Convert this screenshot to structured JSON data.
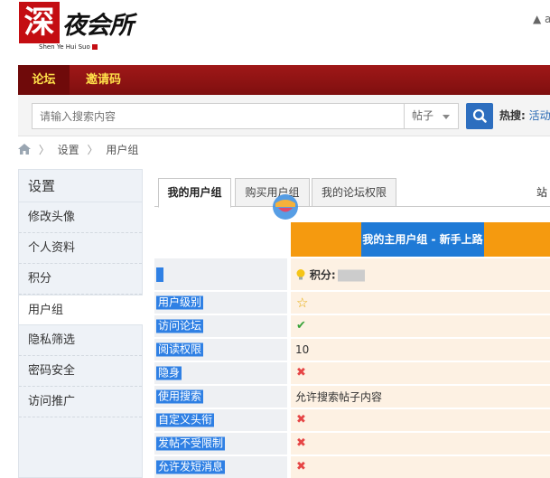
{
  "logo": {
    "mark": "深",
    "name": "夜会所",
    "subtitle": "Shen Ye Hui Suo"
  },
  "user_mini": "▲ a",
  "nav": {
    "items": [
      "论坛",
      "邀请码"
    ]
  },
  "search": {
    "placeholder": "请输入搜索内容",
    "type_value": "帖子",
    "hot_label": "热搜:",
    "hot_item": "活动"
  },
  "breadcrumb": {
    "items": [
      "设置",
      "用户组"
    ]
  },
  "sidebar": {
    "title": "设置",
    "items": [
      "修改头像",
      "个人资料",
      "积分",
      "用户组",
      "隐私筛选",
      "密码安全",
      "访问推广"
    ],
    "active_index": 3
  },
  "tabs": {
    "items": [
      "我的用户组",
      "购买用户组",
      "我的论坛权限"
    ],
    "right_text": "站"
  },
  "group_header": "我的主用户组 - 新手上路",
  "points_label": "积分:",
  "permissions": [
    {
      "label": "用户级别",
      "value": "",
      "mark": "star"
    },
    {
      "label": "访问论坛",
      "value": "",
      "mark": "check"
    },
    {
      "label": "阅读权限",
      "value": "10",
      "mark": ""
    },
    {
      "label": "隐身",
      "value": "",
      "mark": "cross"
    },
    {
      "label": "使用搜索",
      "value": "允许搜索帖子内容",
      "mark": ""
    },
    {
      "label": "自定义头衔",
      "value": "",
      "mark": "cross"
    },
    {
      "label": "发帖不受限制",
      "value": "",
      "mark": "cross"
    },
    {
      "label": "允许发短消息",
      "value": "",
      "mark": "cross"
    }
  ],
  "colors": {
    "nav_bg": "#8e1414",
    "nav_text": "#ffe14a",
    "accent_blue": "#2d6ebf",
    "group_orange": "#f59a0f",
    "group_blue": "#1f7ad6"
  }
}
